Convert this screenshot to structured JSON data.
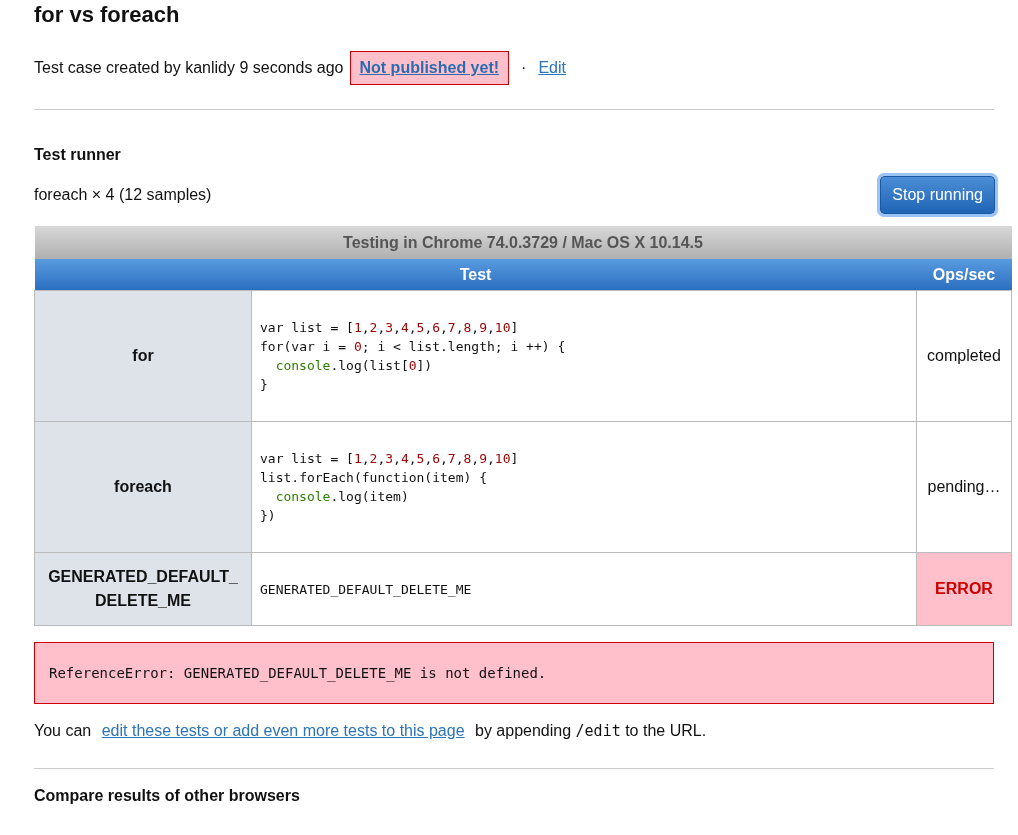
{
  "title": "for vs foreach",
  "meta": {
    "text": "Test case created by kanlidy 9 seconds ago",
    "status_badge": "Not published yet!",
    "separator": "·",
    "edit_link": "Edit"
  },
  "runner": {
    "heading": "Test runner",
    "status": "foreach × 4 (12 samples)",
    "stop_button": "Stop running"
  },
  "table": {
    "caption": "Testing in Chrome 74.0.3729 / Mac OS X 10.14.5",
    "columns": [
      "Test",
      "Ops/sec"
    ],
    "rows": [
      {
        "title": "for",
        "result": "completed",
        "error": false,
        "code": [
          [
            {
              "kind": "plain",
              "text": "var list = ["
            },
            {
              "kind": "number",
              "text": "1"
            },
            {
              "kind": "plain",
              "text": ","
            },
            {
              "kind": "number",
              "text": "2"
            },
            {
              "kind": "plain",
              "text": ","
            },
            {
              "kind": "number",
              "text": "3"
            },
            {
              "kind": "plain",
              "text": ","
            },
            {
              "kind": "number",
              "text": "4"
            },
            {
              "kind": "plain",
              "text": ","
            },
            {
              "kind": "number",
              "text": "5"
            },
            {
              "kind": "plain",
              "text": ","
            },
            {
              "kind": "number",
              "text": "6"
            },
            {
              "kind": "plain",
              "text": ","
            },
            {
              "kind": "number",
              "text": "7"
            },
            {
              "kind": "plain",
              "text": ","
            },
            {
              "kind": "number",
              "text": "8"
            },
            {
              "kind": "plain",
              "text": ","
            },
            {
              "kind": "number",
              "text": "9"
            },
            {
              "kind": "plain",
              "text": ","
            },
            {
              "kind": "number",
              "text": "10"
            },
            {
              "kind": "plain",
              "text": "]"
            }
          ],
          [
            {
              "kind": "plain",
              "text": "for(var i = "
            },
            {
              "kind": "number",
              "text": "0"
            },
            {
              "kind": "plain",
              "text": "; i < list.length; i ++) {"
            }
          ],
          [
            {
              "kind": "indent"
            },
            {
              "kind": "builtin",
              "text": "console"
            },
            {
              "kind": "plain",
              "text": ".log(list["
            },
            {
              "kind": "number",
              "text": "0"
            },
            {
              "kind": "plain",
              "text": "])"
            }
          ],
          [
            {
              "kind": "plain",
              "text": "}"
            }
          ]
        ]
      },
      {
        "title": "foreach",
        "result": "pending…",
        "error": false,
        "code": [
          [
            {
              "kind": "plain",
              "text": "var list = ["
            },
            {
              "kind": "number",
              "text": "1"
            },
            {
              "kind": "plain",
              "text": ","
            },
            {
              "kind": "number",
              "text": "2"
            },
            {
              "kind": "plain",
              "text": ","
            },
            {
              "kind": "number",
              "text": "3"
            },
            {
              "kind": "plain",
              "text": ","
            },
            {
              "kind": "number",
              "text": "4"
            },
            {
              "kind": "plain",
              "text": ","
            },
            {
              "kind": "number",
              "text": "5"
            },
            {
              "kind": "plain",
              "text": ","
            },
            {
              "kind": "number",
              "text": "6"
            },
            {
              "kind": "plain",
              "text": ","
            },
            {
              "kind": "number",
              "text": "7"
            },
            {
              "kind": "plain",
              "text": ","
            },
            {
              "kind": "number",
              "text": "8"
            },
            {
              "kind": "plain",
              "text": ","
            },
            {
              "kind": "number",
              "text": "9"
            },
            {
              "kind": "plain",
              "text": ","
            },
            {
              "kind": "number",
              "text": "10"
            },
            {
              "kind": "plain",
              "text": "]"
            }
          ],
          [
            {
              "kind": "plain",
              "text": "list.forEach(function(item) {"
            }
          ],
          [
            {
              "kind": "indent"
            },
            {
              "kind": "builtin",
              "text": "console"
            },
            {
              "kind": "plain",
              "text": ".log(item)"
            }
          ],
          [
            {
              "kind": "plain",
              "text": "})"
            }
          ]
        ]
      },
      {
        "title": "GENERATED_DEFAULT_DELETE_ME",
        "result": "ERROR",
        "error": true,
        "code": [
          [
            {
              "kind": "plain",
              "text": "GENERATED_DEFAULT_DELETE_ME"
            }
          ]
        ]
      }
    ]
  },
  "error_message": "ReferenceError: GENERATED_DEFAULT_DELETE_ME is not defined.",
  "note": [
    {
      "kind": "text",
      "text": "You can "
    },
    {
      "kind": "link",
      "text": "edit these tests or add even more tests to this page"
    },
    {
      "kind": "text",
      "text": " by appending "
    },
    {
      "kind": "code",
      "text": "/edit"
    },
    {
      "kind": "text",
      "text": " to the URL."
    }
  ],
  "next_heading": "Compare results of other browsers"
}
